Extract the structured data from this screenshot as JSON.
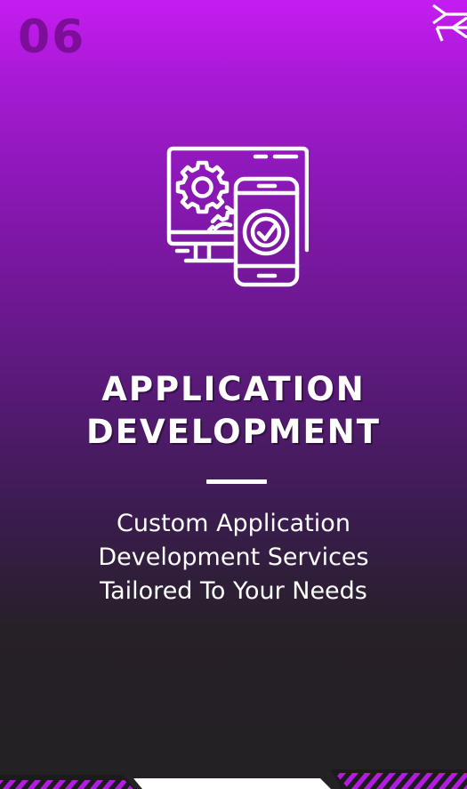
{
  "card": {
    "number": "06",
    "title_line1": "APPLICATION",
    "title_line2": "DEVELOPMENT",
    "description_line1": "Custom Application",
    "description_line2": "Development Services",
    "description_line3": "Tailored To Your Needs"
  },
  "icons": {
    "corner": "arrow-chevron-icon",
    "service": "app-development-icon"
  },
  "colors": {
    "gradient_top": "#c51cf0",
    "gradient_bottom": "#232123",
    "number": "#7d0e99",
    "accent": "#b21be0",
    "text": "#ffffff"
  }
}
